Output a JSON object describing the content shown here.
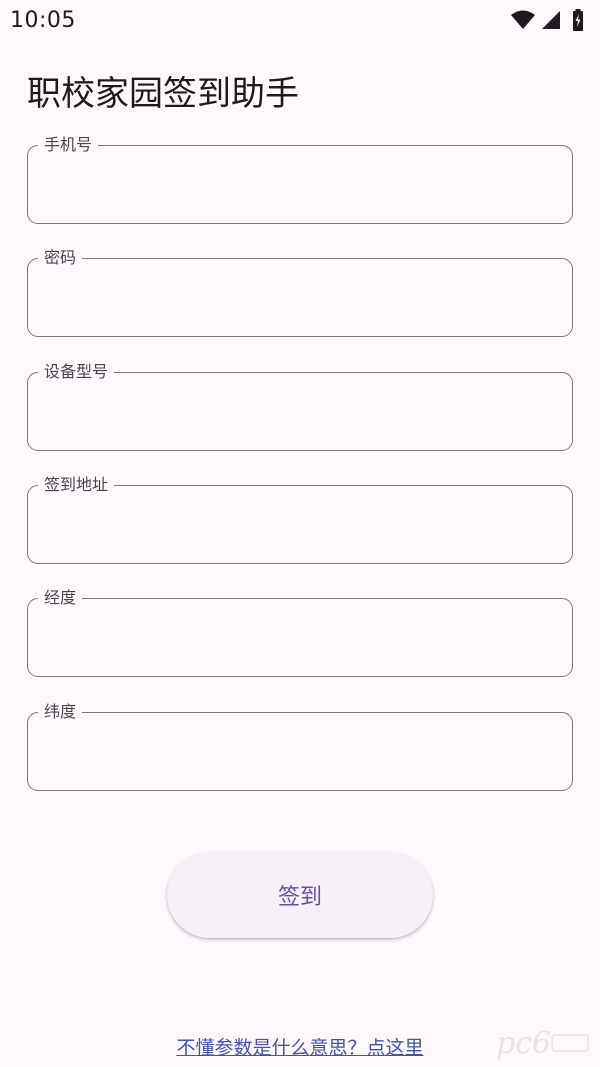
{
  "status_bar": {
    "time": "10:05",
    "icons": [
      "wifi-icon",
      "signal-icon",
      "battery-charging-icon"
    ]
  },
  "app": {
    "title": "职校家园签到助手"
  },
  "form": {
    "fields": [
      {
        "label": "手机号",
        "value": ""
      },
      {
        "label": "密码",
        "value": ""
      },
      {
        "label": "设备型号",
        "value": ""
      },
      {
        "label": "签到地址",
        "value": ""
      },
      {
        "label": "经度",
        "value": ""
      },
      {
        "label": "纬度",
        "value": ""
      }
    ],
    "submit_label": "签到"
  },
  "help_link": "不懂参数是什么意思？点这里",
  "colors": {
    "background": "#FFF9FC",
    "outline": "#79747E",
    "primary": "#6750A4",
    "link": "#3F51B5"
  }
}
